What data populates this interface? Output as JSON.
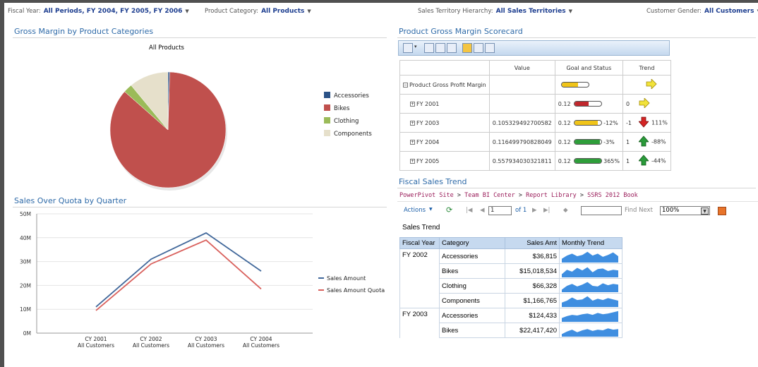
{
  "filters": {
    "fiscal_year": {
      "label": "Fiscal Year:",
      "value": "All Periods, FY 2004, FY 2005, FY 2006"
    },
    "product_category": {
      "label": "Product Category:",
      "value": "All Products"
    },
    "sales_territory": {
      "label": "Sales Territory Hierarchy:",
      "value": "All Sales Territories"
    },
    "customer_gender": {
      "label": "Customer Gender:",
      "value": "All Customers"
    }
  },
  "gross_margin": {
    "title": "Gross Margin by Product Categories",
    "chart_data": {
      "type": "pie",
      "title": "All Products",
      "categories": [
        "Accessories",
        "Bikes",
        "Clothing",
        "Components"
      ],
      "values": [
        0.5,
        86,
        2.5,
        11
      ],
      "colors": [
        "#2b5287",
        "#c0504d",
        "#9bbb59",
        "#e6e0cb"
      ]
    }
  },
  "sales_quota": {
    "title": "Sales Over Quota by Quarter",
    "chart_data": {
      "type": "line",
      "categories": [
        "CY 2001",
        "CY 2002",
        "CY 2003",
        "CY 2004"
      ],
      "category_sub": "All Customers",
      "y_ticks": [
        "0M",
        "10M",
        "20M",
        "30M",
        "40M",
        "50M"
      ],
      "ylim": [
        0,
        50
      ],
      "series": [
        {
          "name": "Sales Amount",
          "values": [
            11,
            31,
            42,
            26
          ],
          "color": "#40679a"
        },
        {
          "name": "Sales Amount Quota",
          "values": [
            9.5,
            29,
            39,
            18.5
          ],
          "color": "#d9605c"
        }
      ]
    }
  },
  "scorecard": {
    "title": "Product Gross Margin Scorecard",
    "headers": [
      "",
      "Value",
      "Goal and Status",
      "Trend"
    ],
    "rows": [
      {
        "name": "Product Gross Profit Margin",
        "value": "",
        "goal": "",
        "status_pct": "",
        "gauge": 0.6,
        "gauge_color": "#f0c419",
        "trend_num": "",
        "trend_icon": "arrow-right",
        "trend_pct": "",
        "expand": "minus"
      },
      {
        "name": "FY 2001",
        "value": "",
        "goal": "0.12",
        "status_pct": "",
        "gauge": 0.55,
        "gauge_color": "#c0272d",
        "trend_num": "0",
        "trend_icon": "arrow-right",
        "trend_pct": "",
        "expand": "plus"
      },
      {
        "name": "FY 2003",
        "value": "0.105329492700582",
        "goal": "0.12",
        "status_pct": "-12%",
        "gauge": 0.88,
        "gauge_color": "#f0c419",
        "trend_num": "-1",
        "trend_icon": "arrow-down",
        "trend_pct": "111%",
        "expand": "plus"
      },
      {
        "name": "FY 2004",
        "value": "0.116499790828049",
        "goal": "0.12",
        "status_pct": "-3%",
        "gauge": 0.97,
        "gauge_color": "#2e9e3a",
        "trend_num": "1",
        "trend_icon": "arrow-up",
        "trend_pct": "-88%",
        "expand": "plus"
      },
      {
        "name": "FY 2005",
        "value": "0.557934030321811",
        "goal": "0.12",
        "status_pct": "365%",
        "gauge": 1.0,
        "gauge_color": "#2e9e3a",
        "trend_num": "1",
        "trend_icon": "arrow-up",
        "trend_pct": "-44%",
        "expand": "plus"
      }
    ]
  },
  "fiscal_sales": {
    "title": "Fiscal Sales Trend",
    "breadcrumb": [
      "PowerPivot Site",
      "Team BI Center",
      "Report Library",
      "SSRS 2012 Book"
    ],
    "toolbar": {
      "actions": "Actions",
      "page": "1",
      "of": "of 1",
      "find_next": "Find Next",
      "zoom": "100%"
    },
    "report_title": "Sales Trend",
    "headers": [
      "Fiscal Year",
      "Category",
      "Sales Amt",
      "Monthly Trend"
    ],
    "rows": [
      {
        "fy": "FY 2002",
        "category": "Accessories",
        "amount": "$36,815"
      },
      {
        "fy": "",
        "category": "Bikes",
        "amount": "$15,018,534"
      },
      {
        "fy": "",
        "category": "Clothing",
        "amount": "$66,328"
      },
      {
        "fy": "",
        "category": "Components",
        "amount": "$1,166,765"
      },
      {
        "fy": "FY 2003",
        "category": "Accessories",
        "amount": "$124,433"
      },
      {
        "fy": "",
        "category": "Bikes",
        "amount": "$22,417,420"
      }
    ]
  }
}
